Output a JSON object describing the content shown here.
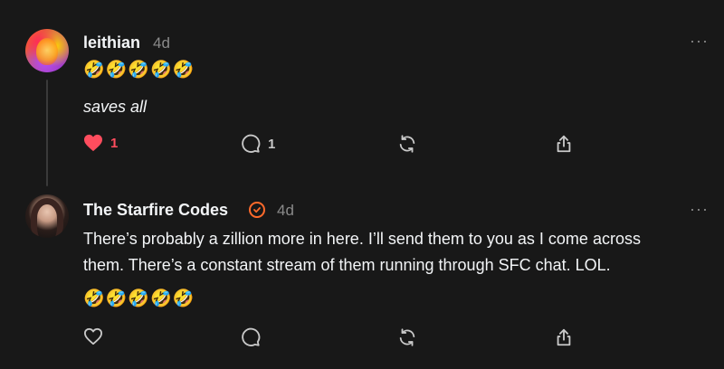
{
  "posts": [
    {
      "username": "leithian",
      "time": "4d",
      "emojis": "🤣🤣🤣🤣🤣",
      "text": "saves all",
      "likes": "1",
      "replies": "1",
      "liked": true
    },
    {
      "username": "The Starfire Codes",
      "time": "4d",
      "verified": true,
      "text_line1": "There’s probably a zillion more in here. I’ll send them to you as I come across",
      "text_line2": "them. There’s a constant stream of them running through SFC chat. LOL.",
      "emojis": "🤣🤣🤣🤣🤣",
      "liked": false
    }
  ],
  "more_label": "···",
  "colors": {
    "accent_like": "#ff4d5e",
    "verified": "#ff6a2b",
    "muted": "#8a8a8a"
  },
  "icons": [
    "heart-icon",
    "comment-icon",
    "repost-icon",
    "share-icon",
    "more-icon",
    "verified-icon"
  ]
}
